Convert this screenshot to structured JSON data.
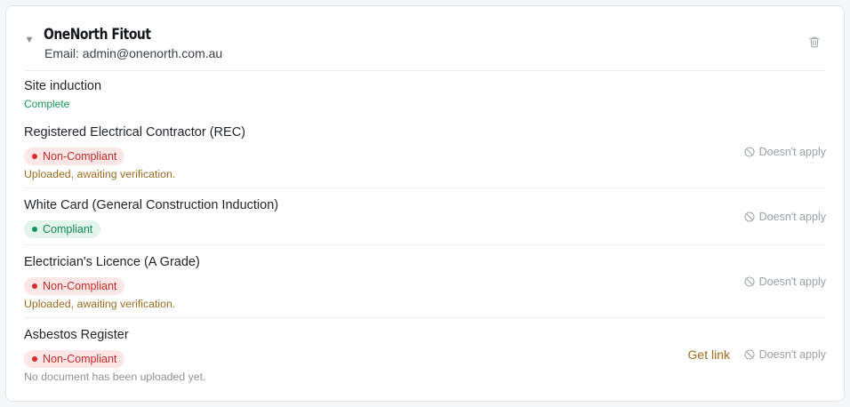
{
  "contractor": {
    "name": "OneNorth Fitout",
    "email": "Email: admin@onenorth.com.au"
  },
  "induction": {
    "title": "Site induction",
    "status": "Complete"
  },
  "items": [
    {
      "title": "Registered Electrical Contractor (REC)",
      "badge": "Non-Compliant",
      "note": "Uploaded, awaiting verification.",
      "action": "Doesn't apply"
    },
    {
      "title": "White Card (General Construction Induction)",
      "badge": "Compliant",
      "action": "Doesn't apply"
    },
    {
      "title": "Electrician's Licence (A Grade)",
      "badge": "Non-Compliant",
      "note": "Uploaded, awaiting verification.",
      "action": "Doesn't apply"
    },
    {
      "title": "Asbestos Register",
      "badge": "Non-Compliant",
      "note": "No document has been uploaded yet.",
      "link": "Get link",
      "action": "Doesn't apply"
    }
  ],
  "colors": {
    "non_compliant": "#c42b2b",
    "compliant": "#10875a",
    "awaiting": "#9a6b1f",
    "complete": "#12955f"
  },
  "icons": {
    "toggle": "caret-down-icon",
    "delete": "trash-icon",
    "not_applicable": "ban-icon"
  }
}
